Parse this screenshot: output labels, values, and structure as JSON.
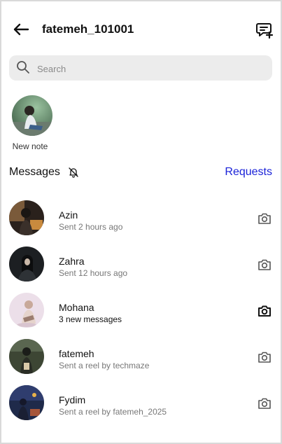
{
  "header": {
    "title": "fatemeh_101001",
    "back_icon": "arrow-left-icon",
    "compose_icon": "new-message-icon"
  },
  "search": {
    "placeholder": "Search",
    "icon": "search-icon"
  },
  "note": {
    "label": "New note"
  },
  "messages_section": {
    "title": "Messages",
    "mute_icon": "bell-off-icon",
    "requests_label": "Requests",
    "requests_color": "#1a22d8"
  },
  "threads": [
    {
      "name": "Azin",
      "status": "Sent 2 hours ago",
      "unread": false
    },
    {
      "name": "Zahra",
      "status": "Sent 12 hours ago",
      "unread": false
    },
    {
      "name": "Mohana",
      "status": "3 new messages",
      "unread": true
    },
    {
      "name": "fatemeh",
      "status": "Sent a reel by techmaze",
      "unread": false
    },
    {
      "name": "Fydim",
      "status": "Sent a reel by fatemeh_2025",
      "unread": false
    }
  ]
}
